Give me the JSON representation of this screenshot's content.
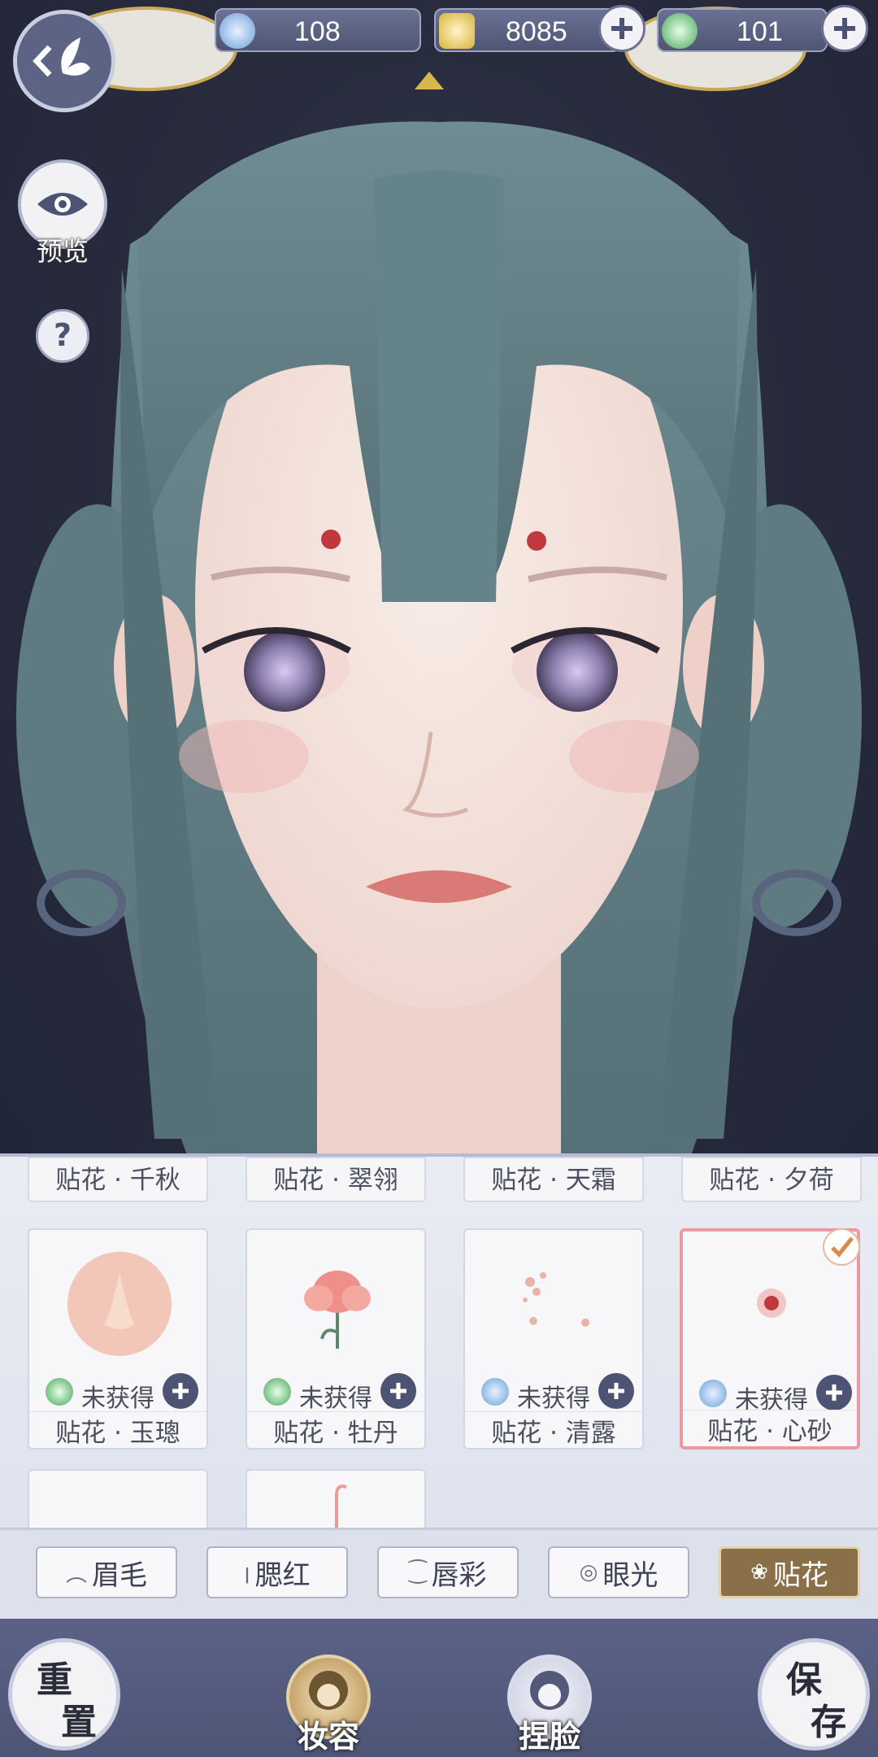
{
  "currency": {
    "jade": "108",
    "coin": "8085",
    "token": "101"
  },
  "preview": {
    "label": "预览"
  },
  "help": {
    "label": "?"
  },
  "stickers": {
    "top_row": [
      "贴花 · 千秋",
      "贴花 · 翠翎",
      "贴花 · 天霜",
      "贴花 · 夕荷"
    ],
    "cards": [
      {
        "name": "贴花 · 玉璁",
        "status": "未获得",
        "coin": "green"
      },
      {
        "name": "贴花 · 牡丹",
        "status": "未获得",
        "coin": "green"
      },
      {
        "name": "贴花 · 清露",
        "status": "未获得",
        "coin": "blue"
      },
      {
        "name": "贴花 · 心砂",
        "status": "未获得",
        "coin": "blue",
        "selected": true
      }
    ]
  },
  "tabs": [
    "眉毛",
    "腮红",
    "唇彩",
    "眼光",
    "贴花"
  ],
  "active_tab": "贴花",
  "bottom": {
    "reset": [
      "重",
      "置"
    ],
    "makeup": "妆容",
    "face": "捏脸",
    "save": [
      "保",
      "存"
    ]
  },
  "colors": {
    "background": "#262a3b",
    "hair": "#5c7a80",
    "accent_gold": "#8a7048",
    "panel": "#e6e9f1"
  }
}
